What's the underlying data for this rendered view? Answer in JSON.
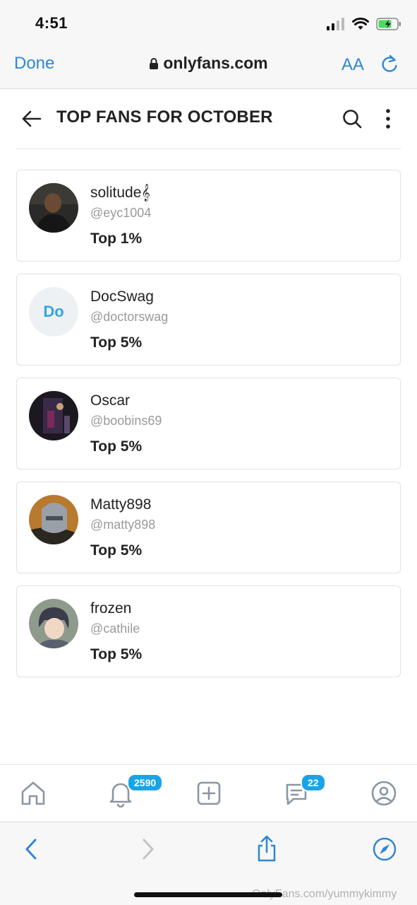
{
  "status_bar": {
    "time": "4:51"
  },
  "browser": {
    "done_label": "Done",
    "url": "onlyfans.com",
    "text_size_label": "AA"
  },
  "page": {
    "title": "TOP FANS FOR OCTOBER"
  },
  "fans": [
    {
      "name": "solitude𝄞",
      "handle": "@eyc1004",
      "rank": "Top 1%",
      "initials": ""
    },
    {
      "name": "DocSwag",
      "handle": "@doctorswag",
      "rank": "Top 5%",
      "initials": "Do"
    },
    {
      "name": "Oscar",
      "handle": "@boobins69",
      "rank": "Top 5%",
      "initials": ""
    },
    {
      "name": "Matty898",
      "handle": "@matty898",
      "rank": "Top 5%",
      "initials": ""
    },
    {
      "name": "frozen",
      "handle": "@cathile",
      "rank": "Top 5%",
      "initials": ""
    }
  ],
  "bottom_nav": {
    "notifications_badge": "2590",
    "messages_badge": "22"
  },
  "watermark": "OnlyFans.com/yummykimmy",
  "colors": {
    "accent": "#2f86d6",
    "badge": "#1aa4e6",
    "icon": "#8a96a3"
  }
}
